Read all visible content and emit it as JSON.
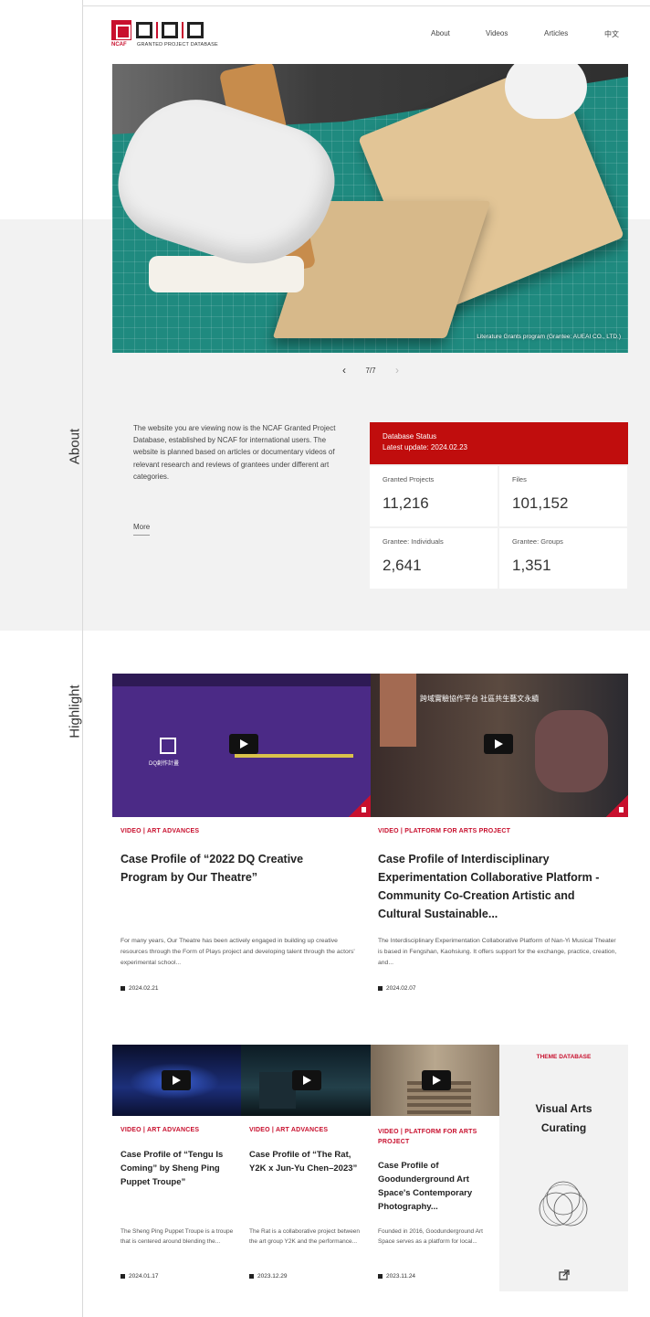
{
  "header": {
    "logo_ncaf": "NCAF",
    "logo_subtitle": "GRANTED PROJECT DATABASE",
    "nav": [
      {
        "label": "About"
      },
      {
        "label": "Videos"
      },
      {
        "label": "Articles"
      },
      {
        "label": "中文"
      }
    ]
  },
  "hero": {
    "caption": "Literature Grants program (Grantee: AUEAI CO., LTD.)",
    "pager": "7/7"
  },
  "sections": {
    "about_label": "About",
    "highlight_label": "Highlight"
  },
  "about": {
    "text": "The website you are viewing now is the NCAF Granted Project Database, established by NCAF for international users. The website is planned based on articles or documentary videos of relevant research and reviews of grantees under different art categories.",
    "more": "More"
  },
  "stats": {
    "title": "Database Status",
    "update": "Latest update: 2024.02.23",
    "items": [
      {
        "label": "Granted Projects",
        "value": "11,216"
      },
      {
        "label": "Files",
        "value": "101,152"
      },
      {
        "label": "Grantee: Individuals",
        "value": "2,641"
      },
      {
        "label": "Grantee: Groups",
        "value": "1,351"
      }
    ]
  },
  "featured": [
    {
      "tag": "VIDEO | ART ADVANCES",
      "title": "Case Profile of “2022 DQ Creative Program by Our Theatre”",
      "desc": "For many years, Our Theatre has been actively engaged in building up creative resources through the Form of Plays project and developing talent through the actors' experimental school...",
      "date": "2024.02.21",
      "thumb_text": "DQ創作計畫"
    },
    {
      "tag": "VIDEO | PLATFORM FOR ARTS PROJECT",
      "title": "Case Profile of Interdisciplinary Experimentation Collaborative Platform - Community Co-Creation Artistic and Cultural Sustainable...",
      "desc": "The Interdisciplinary Experimentation Collaborative Platform of Nan-Yi Musical Theater is based in Fengshan, Kaohsiung. It offers support for the exchange, practice, creation, and...",
      "date": "2024.02.07",
      "thumb_text": "跨域實驗協作平台 社區共生藝文永續"
    }
  ],
  "small_cards": [
    {
      "tag": "VIDEO | ART ADVANCES",
      "title": "Case Profile of “Tengu Is Coming” by Sheng Ping Puppet Troupe”",
      "desc": "The Sheng Ping Puppet Troupe is a troupe that is centered around blending the...",
      "date": "2024.01.17"
    },
    {
      "tag": "VIDEO | ART ADVANCES",
      "title": "Case Profile of “The Rat, Y2K x Jun-Yu Chen–2023”",
      "desc": "The Rat is a collaborative project between the art group Y2K and the performance...",
      "date": "2023.12.29"
    },
    {
      "tag": "VIDEO | PLATFORM FOR ARTS PROJECT",
      "title": "Case Profile of Goodunderground Art Space's Contemporary Photography...",
      "desc": "Founded in 2016, Goodunderground Art Space serves as a platform for local...",
      "date": "2023.11.24"
    }
  ],
  "theme": {
    "tag": "THEME DATABASE",
    "title": "Visual Arts Curating"
  }
}
